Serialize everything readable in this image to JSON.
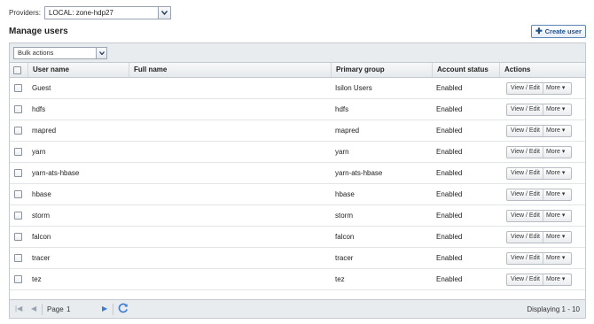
{
  "providers": {
    "label": "Providers:",
    "selected": "LOCAL: zone-hdp27"
  },
  "page_title": "Manage users",
  "create_button": "Create user",
  "bulk_actions": "Bulk actions",
  "columns": [
    "User name",
    "Full name",
    "Primary group",
    "Account status",
    "Actions"
  ],
  "rows": [
    {
      "user": "Guest",
      "full": "",
      "group": "Isilon Users",
      "status": "Enabled"
    },
    {
      "user": "hdfs",
      "full": "",
      "group": "hdfs",
      "status": "Enabled"
    },
    {
      "user": "mapred",
      "full": "",
      "group": "mapred",
      "status": "Enabled"
    },
    {
      "user": "yarn",
      "full": "",
      "group": "yarn",
      "status": "Enabled"
    },
    {
      "user": "yarn-ats-hbase",
      "full": "",
      "group": "yarn-ats-hbase",
      "status": "Enabled"
    },
    {
      "user": "hbase",
      "full": "",
      "group": "hbase",
      "status": "Enabled"
    },
    {
      "user": "storm",
      "full": "",
      "group": "storm",
      "status": "Enabled"
    },
    {
      "user": "falcon",
      "full": "",
      "group": "falcon",
      "status": "Enabled"
    },
    {
      "user": "tracer",
      "full": "",
      "group": "tracer",
      "status": "Enabled"
    },
    {
      "user": "tez",
      "full": "",
      "group": "tez",
      "status": "Enabled"
    }
  ],
  "row_actions": {
    "view_edit": "View / Edit",
    "more": "More ▾"
  },
  "pager": {
    "page_label": "Page",
    "page_value": "1",
    "displaying": "Displaying 1 - 10"
  },
  "icons": {
    "dropdown": "chevron-down-icon",
    "create": "plus-icon",
    "first_page": "first-page-icon",
    "prev_page": "prev-page-icon",
    "next_page": "next-page-icon",
    "refresh": "refresh-icon"
  },
  "colors": {
    "accent": "#1f4f8a",
    "header_bg": "#e9ecef",
    "border": "#c4c9cf",
    "refresh": "#3a7bd5"
  }
}
